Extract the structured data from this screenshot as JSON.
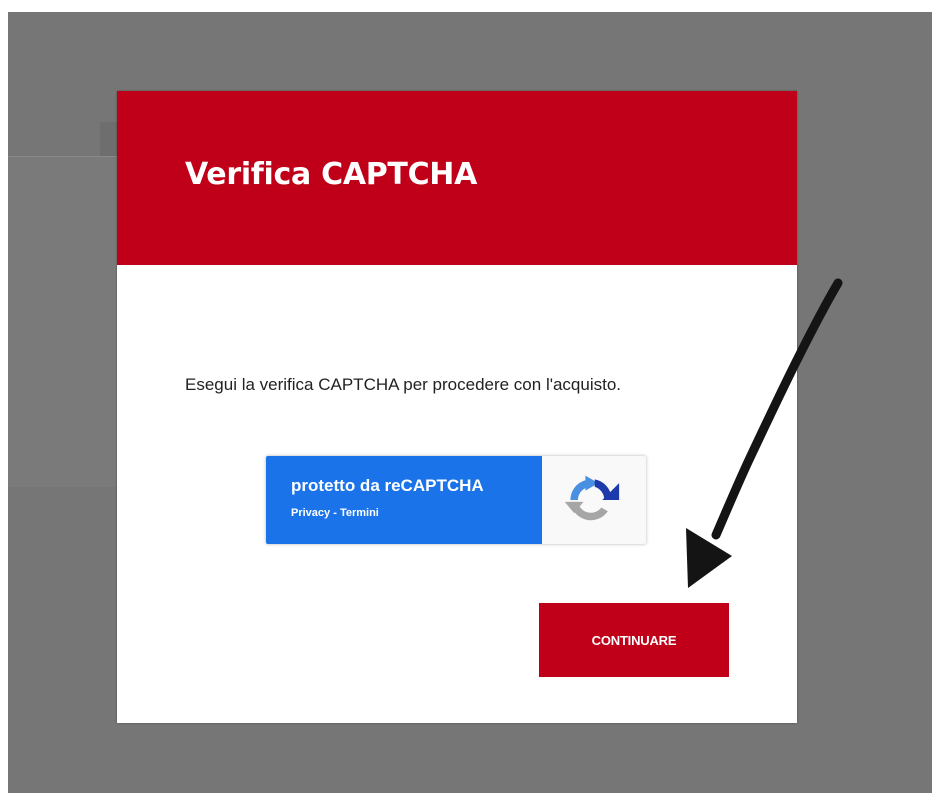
{
  "modal": {
    "title": "Verifica CAPTCHA",
    "message": "Esegui la verifica CAPTCHA per procedere con l'acquisto.",
    "continue_label": "CONTINUARE"
  },
  "recaptcha": {
    "protected_text": "protetto da reCAPTCHA",
    "privacy_label": "Privacy",
    "separator": " - ",
    "terms_label": "Termini",
    "logo_icon": "recaptcha-logo-icon"
  },
  "annotation": {
    "icon": "arrow-annotation-icon"
  },
  "colors": {
    "brand_red": "#c00018",
    "overlay_gray": "#767676",
    "recaptcha_blue": "#1a73e8"
  }
}
